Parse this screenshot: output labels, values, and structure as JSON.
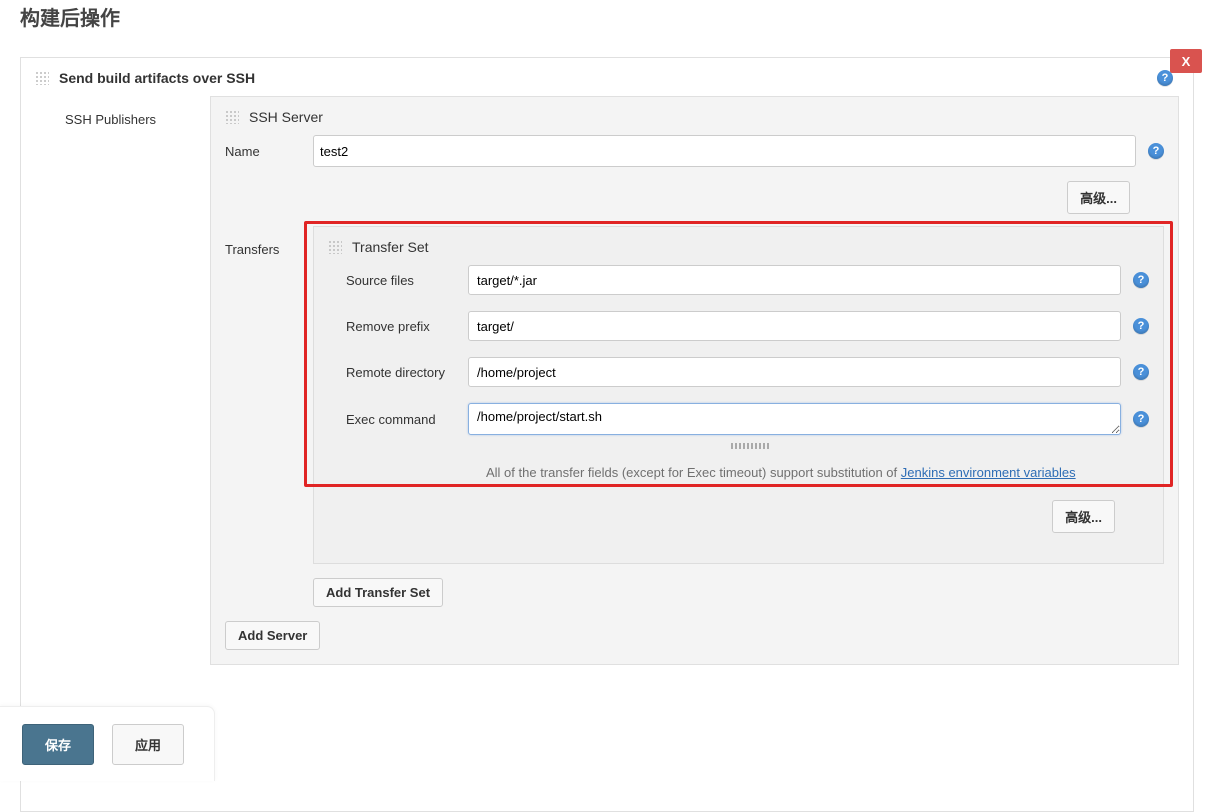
{
  "page": {
    "title": "构建后操作"
  },
  "section": {
    "title": "Send build artifacts over SSH",
    "close_label": "X"
  },
  "ssh": {
    "publishers_label": "SSH Publishers",
    "server_label": "SSH Server",
    "name_label": "Name",
    "name_value": "test2",
    "advanced_label": "高级...",
    "transfers_label": "Transfers",
    "transfer_set_label": "Transfer Set",
    "fields": {
      "source_files_label": "Source files",
      "source_files_value": "target/*.jar",
      "remove_prefix_label": "Remove prefix",
      "remove_prefix_value": "target/",
      "remote_dir_label": "Remote directory",
      "remote_dir_value": "/home/project",
      "exec_command_label": "Exec command",
      "exec_command_value": "/home/project/start.sh"
    },
    "hint_prefix": "All of the transfer fields (except for Exec timeout) support substitution of ",
    "hint_link": "Jenkins environment variables",
    "add_transfer_set": "Add Transfer Set",
    "add_server": "Add Server"
  },
  "footer": {
    "save": "保存",
    "apply": "应用"
  }
}
